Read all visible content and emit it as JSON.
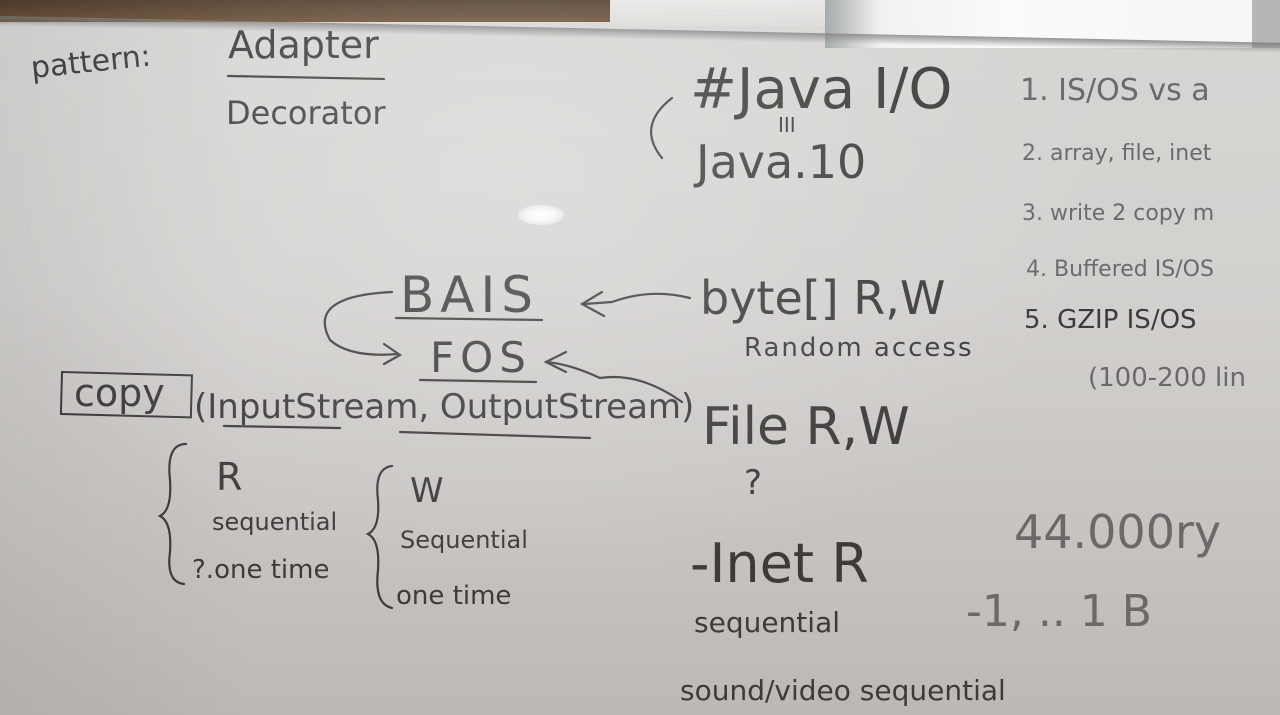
{
  "board": {
    "pattern_label": "pattern:",
    "pattern_primary": "Adapter",
    "pattern_secondary": "Decorator",
    "topic_title": "#Java I/O",
    "topic_version": "Java.10",
    "topic_marks": "III",
    "agenda": [
      "1. IS/OS vs a",
      "2. array, file, inet",
      "3. write 2 copy m",
      "4. Buffered IS/OS",
      "5. GZIP IS/OS"
    ],
    "lines_note": "(100-200 lin",
    "bais_label": "BAIS",
    "fos_label": "FOS",
    "bytes_label": "byte[] R,W",
    "random_access": "Random access",
    "copy_word": "copy",
    "copy_params": "(InputStream, OutputStream)",
    "file_label": "File R,W",
    "file_question": "?",
    "r_label": "R",
    "r_sequential": "sequential",
    "r_one_time": "?.one time",
    "w_label": "W",
    "w_sequential": "Sequential",
    "w_one_time": "one time",
    "inet_label": "-Inet R",
    "inet_sequential": "sequential",
    "sound_video": "sound/video sequential",
    "count_value": "44.000ry",
    "range_value": "-1, .. 1 B"
  }
}
